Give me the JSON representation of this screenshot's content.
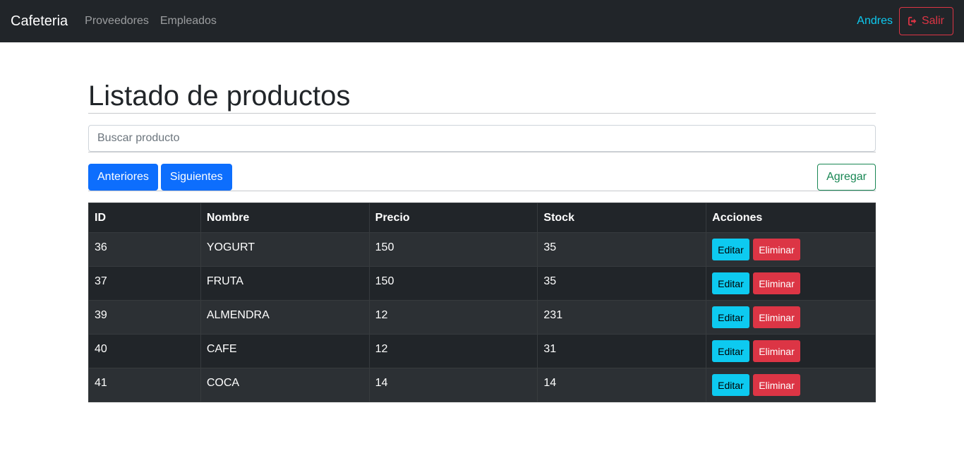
{
  "navbar": {
    "brand": "Cafeteria",
    "links": [
      "Proveedores",
      "Empleados"
    ],
    "user": "Andres",
    "exit_label": "Salir",
    "exit_icon": "sign-out-icon"
  },
  "page": {
    "title": "Listado de productos",
    "search_placeholder": "Buscar producto",
    "prev_label": "Anteriores",
    "next_label": "Siguientes",
    "add_label": "Agregar"
  },
  "table": {
    "headers": [
      "ID",
      "Nombre",
      "Precio",
      "Stock",
      "Acciones"
    ],
    "edit_label": "Editar",
    "delete_label": "Eliminar",
    "rows": [
      [
        "36",
        "YOGURT",
        "150",
        "35"
      ],
      [
        "37",
        "FRUTA",
        "150",
        "35"
      ],
      [
        "39",
        "ALMENDRA",
        "12",
        "231"
      ],
      [
        "40",
        "CAFE",
        "12",
        "31"
      ],
      [
        "41",
        "COCA",
        "14",
        "14"
      ]
    ]
  },
  "colors": {
    "navbar_bg": "#212529",
    "primary": "#0d6efd",
    "info": "#0dcaf0",
    "danger": "#dc3545",
    "success": "#198754"
  }
}
